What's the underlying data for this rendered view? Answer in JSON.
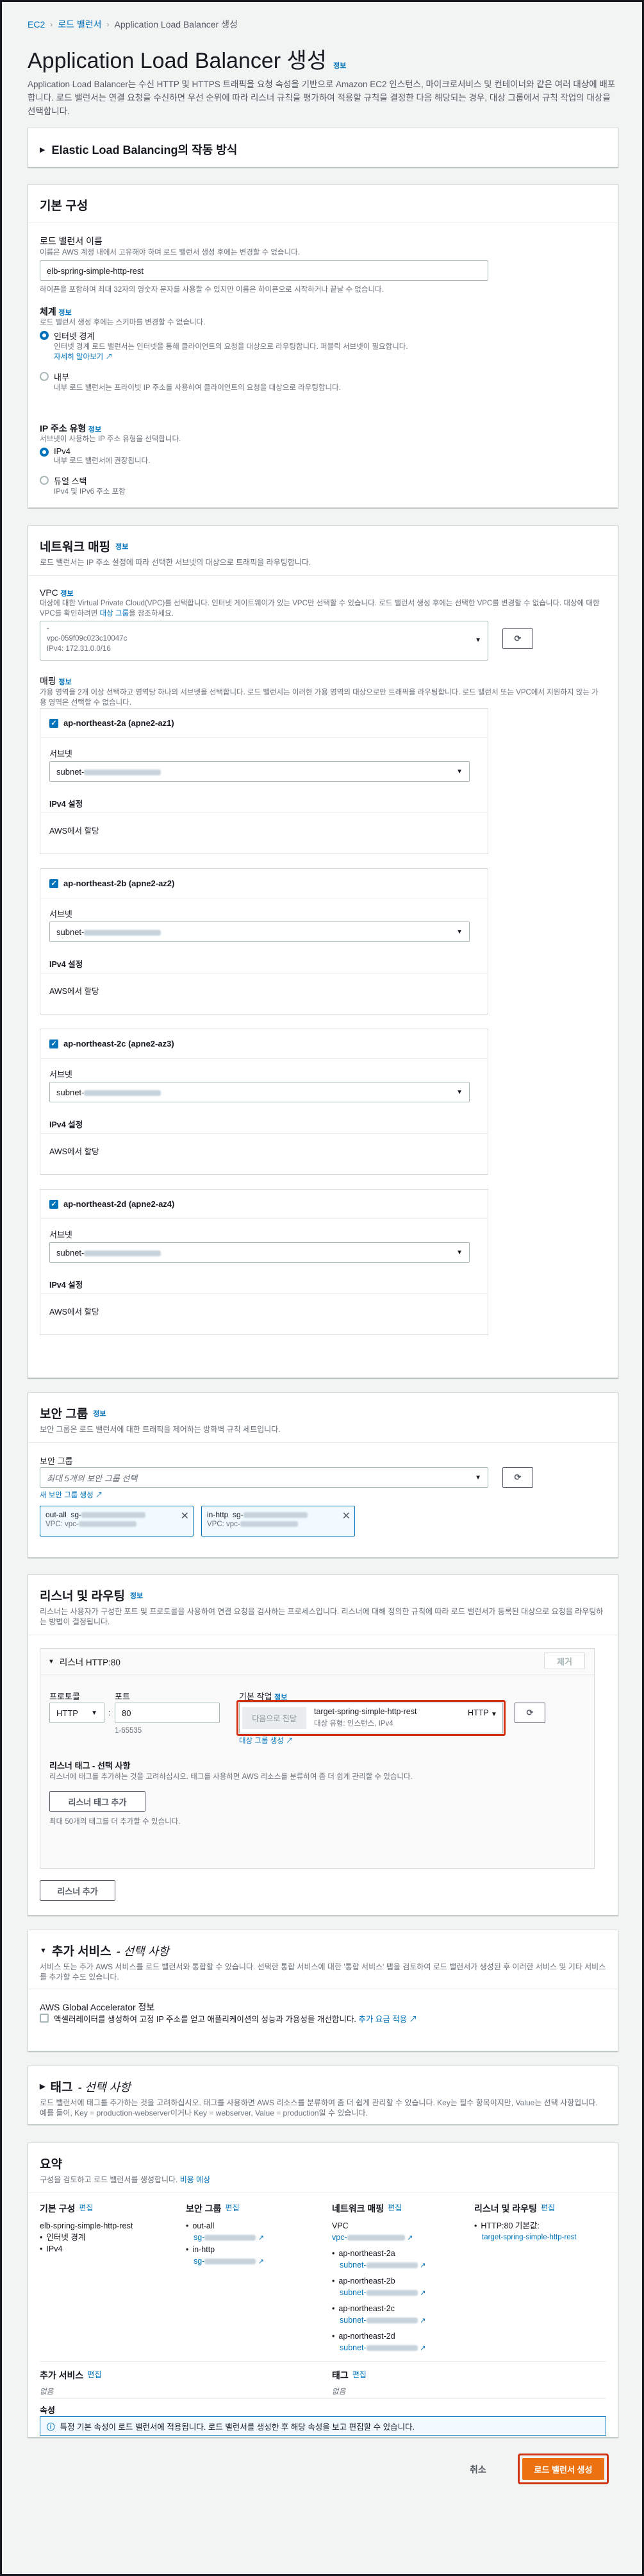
{
  "breadcrumb": {
    "ec2": "EC2",
    "lb": "로드 밸런서",
    "current": "Application Load Balancer 생성"
  },
  "page": {
    "title": "Application Load Balancer 생성",
    "info": "정보",
    "desc": "Application Load Balancer는 수신 HTTP 및 HTTPS 트래픽을 요청 속성을 기반으로 Amazon EC2 인스턴스, 마이크로서비스 및 컨테이너와 같은 여러 대상에 배포합니다. 로드 밸런서는 연결 요청을 수신하면 우선 순위에 따라 리스너 규칙을 평가하여 적용할 규칙을 결정한 다음 해당되는 경우, 대상 그룹에서 규칙 작업의 대상을 선택합니다."
  },
  "how": {
    "title": "Elastic Load Balancing의 작동 방식"
  },
  "basic": {
    "title": "기본 구성",
    "name_label": "로드 밸런서 이름",
    "name_desc": "이름은 AWS 계정 내에서 고유해야 하며 로드 밸런서 생성 후에는 변경할 수 없습니다.",
    "name_value": "elb-spring-simple-http-rest",
    "name_hint": "하이픈을 포함하여 최대 32자의 영숫자 문자를 사용할 수 있지만 이름은 하이픈으로 시작하거나 끝날 수 없습니다.",
    "scheme_label": "체계",
    "scheme_info": "정보",
    "scheme_desc": "로드 밸런서 생성 후에는 스키마를 변경할 수 없습니다.",
    "internet_label": "인터넷 경계",
    "internet_desc": "인터넷 경계 로드 밸런서는 인터넷을 통해 클라이언트의 요청을 대상으로 라우팅합니다. 퍼블릭 서브넷이 필요합니다.",
    "internet_more": "자세히 알아보기",
    "internal_label": "내부",
    "internal_desc": "내부 로드 밸런서는 프라이빗 IP 주소를 사용하여 클라이언트의 요청을 대상으로 라우팅합니다.",
    "ip_label": "IP 주소 유형",
    "ip_info": "정보",
    "ip_desc": "서브넷이 사용하는 IP 주소 유형을 선택합니다.",
    "ipv4_label": "IPv4",
    "ipv4_desc": "내부 로드 밸런서에 권장됩니다.",
    "dual_label": "듀얼 스택",
    "dual_desc": "IPv4 및 IPv6 주소 포함"
  },
  "network": {
    "title": "네트워크 매핑",
    "info": "정보",
    "desc": "로드 밸런서는 IP 주소 설정에 따라 선택한 서브넷의 대상으로 트래픽을 라우팅합니다.",
    "vpc_label": "VPC",
    "vpc_info": "정보",
    "vpc_desc": "대상에 대한 Virtual Private Cloud(VPC)를 선택합니다. 인터넷 게이트웨이가 있는 VPC만 선택할 수 있습니다. 로드 밸런서 생성 후에는 선택한 VPC를 변경할 수 없습니다. 대상에 대한 VPC를 확인하려면",
    "vpc_desc_link": "대상 그룹",
    "vpc_desc_end": "을 참조하세요.",
    "vpc_dash": "-",
    "vpc_id": "vpc-059f09c023c10047c",
    "vpc_cidr": "IPv4: 172.31.0.0/16",
    "mapping_label": "매핑",
    "mapping_info": "정보",
    "mapping_desc": "가용 영역을 2개 이상 선택하고 영역당 하나의 서브넷을 선택합니다. 로드 밸런서는 이러한 가용 영역의 대상으로만 트래픽을 라우팅합니다. 로드 밸런서 또는 VPC에서 지원하지 않는 가용 영역은 선택할 수 없습니다.",
    "subnet_label": "서브넷",
    "ipv4_setting": "IPv4 설정",
    "aws_assign": "AWS에서 할당",
    "zones": [
      {
        "name": "ap-northeast-2a (apne2-az1)",
        "subnet": "subnet-"
      },
      {
        "name": "ap-northeast-2b (apne2-az2)",
        "subnet": "subnet-"
      },
      {
        "name": "ap-northeast-2c (apne2-az3)",
        "subnet": "subnet-"
      },
      {
        "name": "ap-northeast-2d (apne2-az4)",
        "subnet": "subnet-"
      }
    ]
  },
  "security": {
    "title": "보안 그룹",
    "info": "정보",
    "desc": "보안 그룹은 로드 밸런서에 대한 트래픽을 제어하는 방화벽 규칙 세트입니다.",
    "sg_label": "보안 그룹",
    "sg_placeholder": "최대 5개의 보안 그룹 선택",
    "sg_new": "새 보안 그룹 생성",
    "chips": [
      {
        "name": "out-all",
        "id": "sg-",
        "vpc": "VPC: vpc-"
      },
      {
        "name": "in-http",
        "id": "sg-",
        "vpc": "VPC: vpc-"
      }
    ]
  },
  "listeners": {
    "title": "리스너 및 라우팅",
    "info": "정보",
    "desc": "리스너는 사용자가 구성한 포트 및 프로토콜을 사용하여 연결 요청을 검사하는 프로세스입니다. 리스너에 대해 정의한 규칙에 따라 로드 밸런서가 등록된 대상으로 요청을 라우팅하는 방법이 결정됩니다.",
    "listener_title": "리스너 HTTP:80",
    "remove": "제거",
    "protocol_label": "프로토콜",
    "protocol": "HTTP",
    "port_label": "포트",
    "port": "80",
    "port_hint": "1-65535",
    "default_label": "기본 작업",
    "default_info": "정보",
    "forward": "다음으로 전달",
    "tg_name": "target-spring-simple-http-rest",
    "tg_proto": "HTTP",
    "tg_desc": "대상 유형: 인스턴스, IPv4",
    "tg_create": "대상 그룹 생성",
    "tags_label": "리스너 태그 - 선택 사항",
    "tags_desc": "리스너에 태그를 추가하는 것을 고려하십시오. 태그를 사용하면 AWS 리소스를 분류하여 좀 더 쉽게 관리할 수 있습니다.",
    "add_tag": "리스너 태그 추가",
    "tag_limit": "최대 50개의 태그를 더 추가할 수 있습니다.",
    "add_listener": "리스너 추가"
  },
  "addons": {
    "title": "추가 서비스",
    "opt": "- 선택 사항",
    "desc": "서비스 또는 추가 AWS 서비스를 로드 밸런서와 통합할 수 있습니다. 선택한 통합 서비스에 대한 '통합 서비스' 탭을 검토하여 로드 밸런서가 생성된 후 이러한 서비스 및 기타 서비스를 추가할 수도 있습니다.",
    "ga_label": "AWS Global Accelerator 정보",
    "ga_check": "액셀러레이터를 생성하여 고정 IP 주소를 얻고 애플리케이션의 성능과 가용성을 개선합니다.",
    "ga_link": "추가 요금 적용"
  },
  "tags": {
    "title": "태그",
    "opt": "- 선택 사항",
    "desc": "로드 밸런서에 태그를 추가하는 것을 고려하십시오. 태그를 사용하면 AWS 리소스를 분류하여 좀 더 쉽게 관리할 수 있습니다. Key는 필수 항목이지만, Value는 선택 사항입니다. 예를 들어, Key = production-webserver이거나 Key = webserver, Value = production일 수 있습니다."
  },
  "summary": {
    "title": "요약",
    "desc": "구성을 검토하고 로드 밸런서를 생성합니다.",
    "desc_link": "비용 예상",
    "basic_title": "기본 구성",
    "edit": "편집",
    "basic_items": [
      "elb-spring-simple-http-rest",
      "인터넷 경계",
      "IPv4"
    ],
    "sg_title": "보안 그룹",
    "sg_items": [
      "out-all",
      "in-http"
    ],
    "sg_sub": "sg-",
    "net_title": "네트워크 매핑",
    "net_vpc": "VPC",
    "net_vpc_val": "vpc-",
    "net_zones": [
      "ap-northeast-2a",
      "ap-northeast-2b",
      "ap-northeast-2c",
      "ap-northeast-2d"
    ],
    "net_sub": "subnet-",
    "lr_title": "리스너 및 라우팅",
    "lr_item": "HTTP:80 기본값:",
    "lr_tg": "target-spring-simple-http-rest",
    "addon_title": "추가 서비스",
    "addon_edit": "편집",
    "addon_val": "없음",
    "tag_title": "태그",
    "tag_edit": "편집",
    "tag_val": "없음",
    "attr_title": "속성",
    "attr_msg": "특정 기본 속성이 로드 밸런서에 적용됩니다. 로드 밸런서를 생성한 후 해당 속성을 보고 편집할 수 있습니다."
  },
  "footer": {
    "cancel": "취소",
    "create": "로드 밸런서 생성"
  },
  "colors": {
    "accent": "#0073bb",
    "primary": "#ec7211",
    "highlight": "#d13212"
  }
}
